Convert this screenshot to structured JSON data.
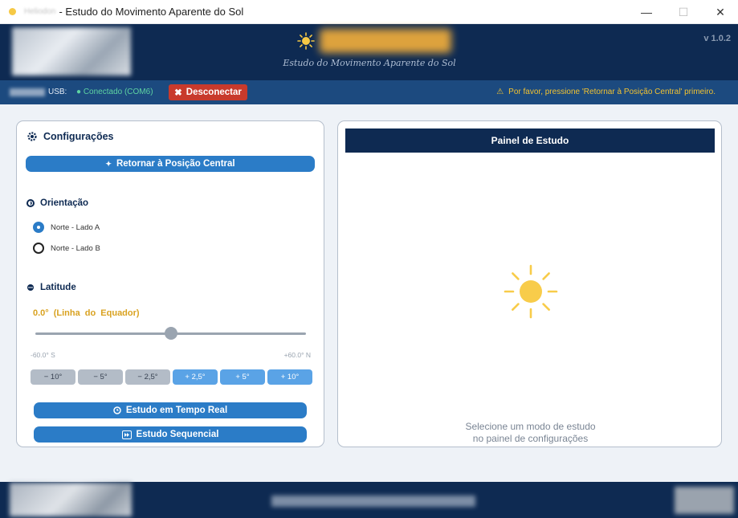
{
  "window": {
    "app_name": "Heliodon",
    "title": "- Estudo do Movimento Aparente do Sol",
    "minimize": "—",
    "maximize": "☐",
    "close": "✕"
  },
  "header": {
    "subtitle": "Estudo do Movimento Aparente do Sol",
    "version": "v 1.0.2",
    "sun_icon": "sun-icon",
    "accent_color": "#f6c945"
  },
  "statusbar": {
    "usb_label": "USB:",
    "connection_status": "● Conectado  (COM6)",
    "disconnect_label": "Desconectar",
    "warning": "Por favor, pressione 'Retornar à Posição Central' primeiro.",
    "warning_icon": "⚠"
  },
  "config": {
    "title": "Configurações",
    "center_button": "Retornar à Posição Central",
    "orientation": {
      "title": "Orientação",
      "options": [
        {
          "label": "Norte - Lado A",
          "selected": true
        },
        {
          "label": "Norte - Lado B",
          "selected": false
        }
      ]
    },
    "latitude": {
      "title": "Latitude",
      "value_text": "0.0°  (Linha do Equador)",
      "value": 0.0,
      "min": -60,
      "max": 60,
      "min_label": "-60.0° S",
      "max_label": "+60.0° N",
      "steps": [
        "−  10°",
        "−  5°",
        "−  2,5°",
        "+  2,5°",
        "+  5°",
        "+  10°"
      ]
    },
    "realtime_button": "Estudo em Tempo Real",
    "sequential_button": "Estudo Sequencial"
  },
  "study": {
    "title": "Painel de Estudo",
    "message_line1": "Selecione um modo de estudo",
    "message_line2": "no painel de configurações"
  }
}
